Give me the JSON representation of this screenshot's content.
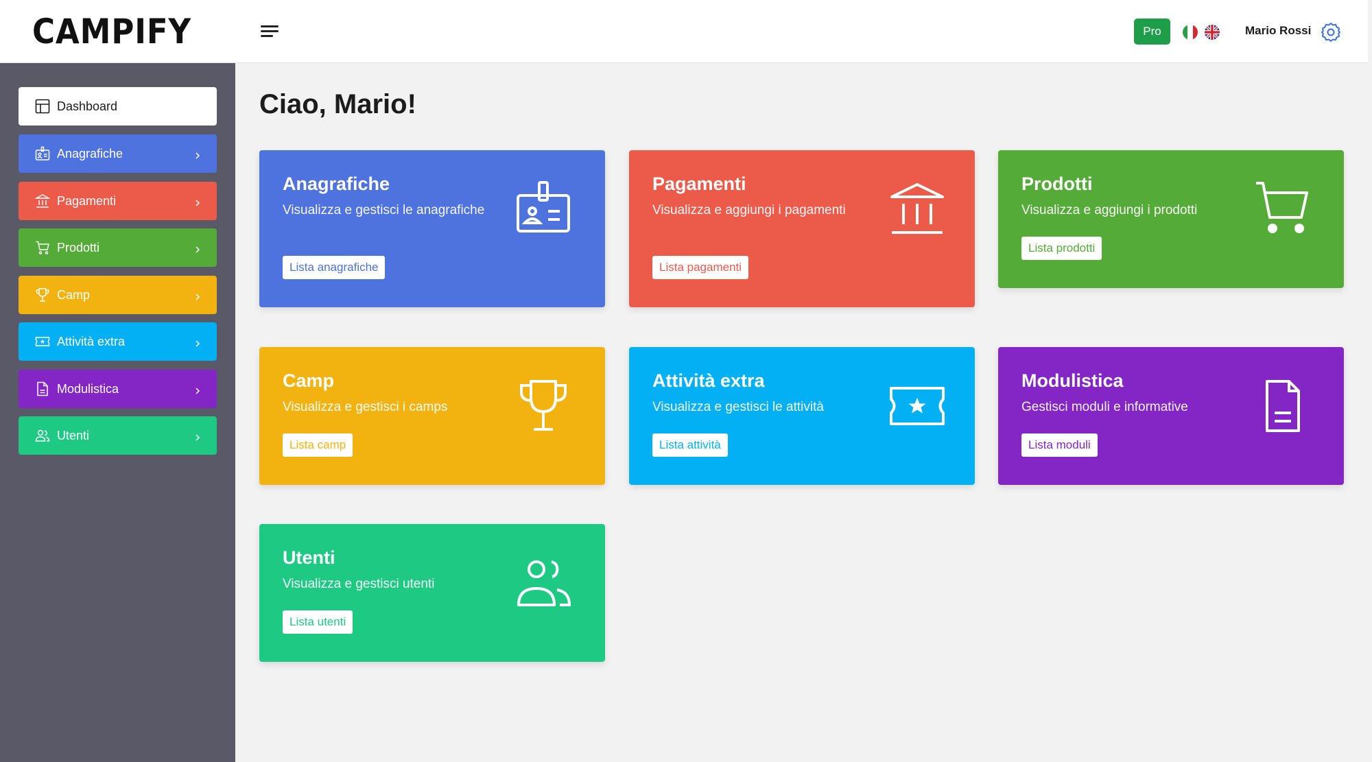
{
  "app": {
    "logo": "CAMPIFY"
  },
  "header": {
    "plan_badge": "Pro",
    "user_name": "Mario Rossi"
  },
  "sidebar": {
    "items": [
      {
        "label": "Dashboard",
        "icon": "dashboard-icon",
        "color": "#ffffff"
      },
      {
        "label": "Anagrafiche",
        "icon": "id-badge-icon",
        "color": "#4e72de"
      },
      {
        "label": "Pagamenti",
        "icon": "bank-icon",
        "color": "#ec5a4a"
      },
      {
        "label": "Prodotti",
        "icon": "cart-icon",
        "color": "#54ab38"
      },
      {
        "label": "Camp",
        "icon": "trophy-icon",
        "color": "#f2b310"
      },
      {
        "label": "Attività extra",
        "icon": "ticket-icon",
        "color": "#03b0f4"
      },
      {
        "label": "Modulistica",
        "icon": "document-icon",
        "color": "#8425c5"
      },
      {
        "label": "Utenti",
        "icon": "users-icon",
        "color": "#1ec984"
      }
    ]
  },
  "main": {
    "greeting": "Ciao, Mario!",
    "cards": [
      {
        "title": "Anagrafiche",
        "description": "Visualizza e gestisci le anagrafiche",
        "button": "Lista anagrafiche",
        "icon": "id-badge-icon",
        "color": "#4e72de"
      },
      {
        "title": "Pagamenti",
        "description": "Visualizza e aggiungi i pagamenti",
        "button": "Lista pagamenti",
        "icon": "bank-icon",
        "color": "#ec5a4a"
      },
      {
        "title": "Prodotti",
        "description": "Visualizza e aggiungi i prodotti",
        "button": "Lista prodotti",
        "icon": "cart-icon",
        "color": "#54ab38"
      },
      {
        "title": "Camp",
        "description": "Visualizza e gestisci i camps",
        "button": "Lista camp",
        "icon": "trophy-icon",
        "color": "#f2b310"
      },
      {
        "title": "Attività extra",
        "description": "Visualizza e gestisci le attività",
        "button": "Lista attività",
        "icon": "ticket-icon",
        "color": "#03b0f4"
      },
      {
        "title": "Modulistica",
        "description": "Gestisci moduli e informative",
        "button": "Lista moduli",
        "icon": "document-icon",
        "color": "#8425c5"
      },
      {
        "title": "Utenti",
        "description": "Visualizza e gestisci utenti",
        "button": "Lista utenti",
        "icon": "users-icon",
        "color": "#1ec984"
      }
    ]
  }
}
